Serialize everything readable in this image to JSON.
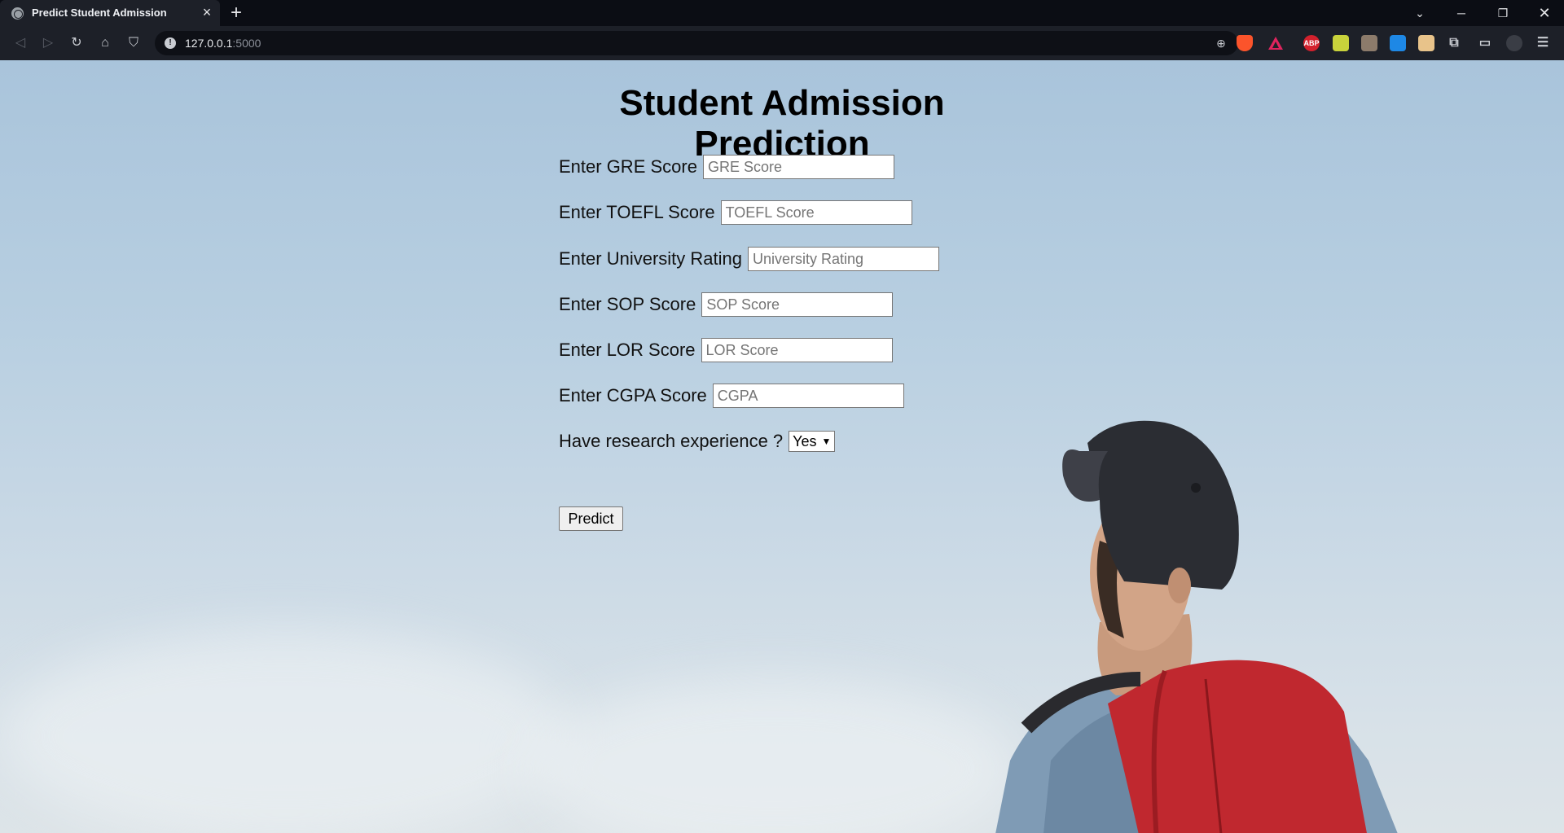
{
  "browser": {
    "tab_title": "Predict Student Admission",
    "url_host": "127.0.0.1",
    "url_port": ":5000",
    "extensions": [
      {
        "name": "abp-icon",
        "label": "ABP",
        "color": "#d3212d"
      },
      {
        "name": "screenshot-extension-icon",
        "label": "",
        "color": "#c8d23b"
      },
      {
        "name": "face-extension-icon",
        "label": "",
        "color": "#8c7b6b"
      },
      {
        "name": "diamond-extension-icon",
        "label": "",
        "color": "#1e88e5"
      },
      {
        "name": "notes-extension-icon",
        "label": "",
        "color": "#e8c38a"
      }
    ]
  },
  "page": {
    "title": "Student Admission Prediction",
    "fields": {
      "gre": {
        "label": "Enter GRE Score",
        "placeholder": "GRE Score"
      },
      "toefl": {
        "label": "Enter TOEFL Score",
        "placeholder": "TOEFL Score"
      },
      "university": {
        "label": "Enter University Rating",
        "placeholder": "University Rating"
      },
      "sop": {
        "label": "Enter SOP Score",
        "placeholder": "SOP Score"
      },
      "lor": {
        "label": "Enter LOR Score",
        "placeholder": "LOR Score"
      },
      "cgpa": {
        "label": "Enter CGPA Score",
        "placeholder": "CGPA"
      }
    },
    "research": {
      "label": "Have research experience ?",
      "selected": "Yes"
    },
    "predict_label": "Predict"
  }
}
